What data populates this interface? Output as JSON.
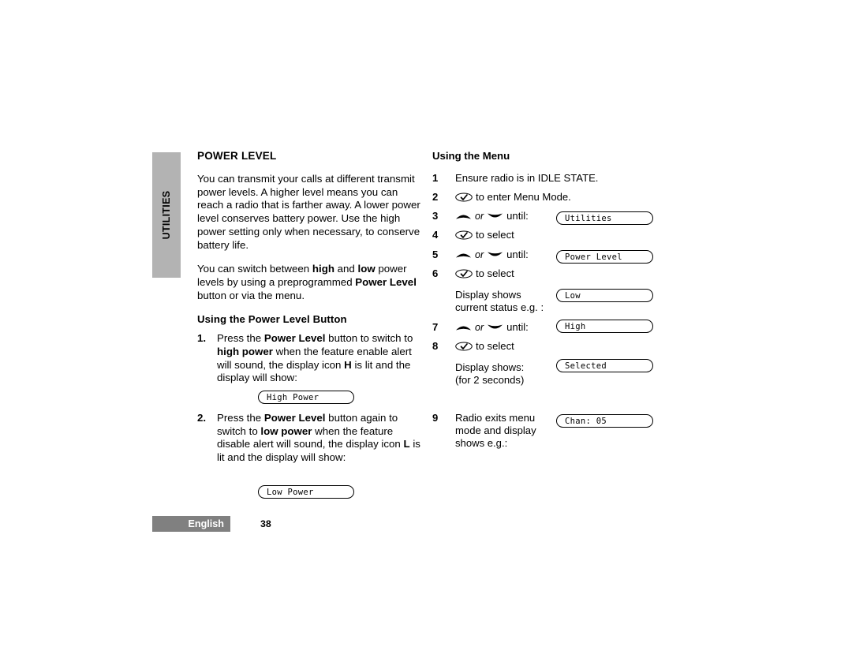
{
  "section_tab": {
    "label": "UTILITIES",
    "background": "#b3b3b3"
  },
  "left_column": {
    "heading": "POWER LEVEL",
    "paragraph_1": "You can transmit your calls at different transmit power levels. A higher level means you can reach a radio that is farther away. A lower power level conserves battery power. Use the high power setting only when necessary, to conserve battery life.",
    "paragraph_2_part_1": "You can switch between ",
    "paragraph_2_bold_1": "high",
    "paragraph_2_part_2": " and ",
    "paragraph_2_bold_2": "low",
    "paragraph_2_part_3": " power levels by using a preprogrammed ",
    "paragraph_2_bold_3": "Power Level",
    "paragraph_2_part_4": " button or via the menu.",
    "subheading": "Using the Power Level Button",
    "steps": [
      {
        "number": "1.",
        "part_1": "Press the ",
        "bold_1": "Power Level",
        "part_2": " button to switch to ",
        "bold_2": "high power",
        "part_3": " when the feature enable alert will sound, the display icon ",
        "bold_3": "H",
        "part_4": " is lit and the display will show:",
        "display": "High Power"
      },
      {
        "number": "2.",
        "part_1": "Press the ",
        "bold_1": "Power Level",
        "part_2": " button again to switch to ",
        "bold_2": "low power",
        "part_3": " when the feature disable alert  will sound, the display icon ",
        "bold_3": "L",
        "part_4": " is lit and the display will show:",
        "display": "Low Power"
      }
    ]
  },
  "right_column": {
    "heading": "Using the Menu",
    "words": {
      "or": "or",
      "until": "until:"
    },
    "steps": [
      {
        "number": "1",
        "text": "Ensure radio is in IDLE STATE."
      },
      {
        "number": "2",
        "text": "to enter Menu Mode."
      },
      {
        "number": "3",
        "text": "until:"
      },
      {
        "number": "4",
        "text": "to select"
      },
      {
        "number": "5",
        "text": "until:"
      },
      {
        "number": "6",
        "text": "to select"
      },
      {
        "number": "7",
        "text": "until:"
      },
      {
        "number": "8",
        "text": "to select"
      },
      {
        "number": "9",
        "text": "Radio exits menu mode and display shows e.g.:"
      }
    ],
    "notes": {
      "status_line_1": "Display shows",
      "status_line_2": "current status e.g. :",
      "selected_line_1": "Display shows:",
      "selected_line_2": "(for 2 seconds)",
      "exit_line_1": "Radio exits menu",
      "exit_line_2": "mode and display",
      "exit_line_3": "shows e.g.:"
    },
    "displays": {
      "utilities": "Utilities",
      "power_level": "Power Level",
      "low": "Low",
      "high": "High",
      "selected": "Selected",
      "channel": "Chan: 05"
    }
  },
  "footer": {
    "language": "English",
    "page_number": "38",
    "band_color": "#808080"
  }
}
